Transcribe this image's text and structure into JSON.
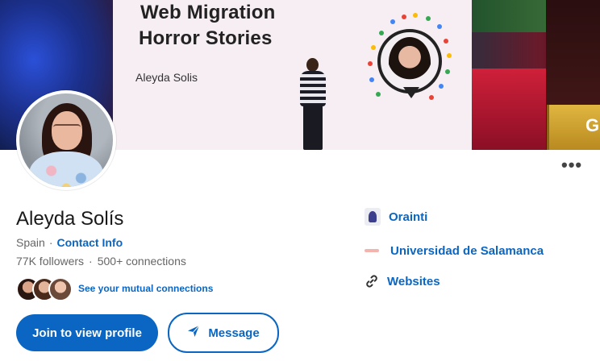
{
  "cover": {
    "talk_title_line1": "Web Migration",
    "talk_title_line2": "Horror Stories",
    "speaker_name": "Aleyda Solis",
    "podium_letter": "G"
  },
  "profile": {
    "name": "Aleyda Solís",
    "location": "Spain",
    "contact_info_label": "Contact Info",
    "followers": "77K followers",
    "connections": "500+ connections",
    "mutual_label": "See your mutual connections"
  },
  "actions": {
    "join_label": "Join to view profile",
    "message_label": "Message",
    "more_label": "•••"
  },
  "sidebar": {
    "company": "Orainti",
    "education": "Universidad de Salamanca",
    "websites": "Websites"
  },
  "icons": {
    "company": "orainti-logo-icon",
    "education": "university-logo-icon",
    "websites": "link-icon",
    "message": "send-icon",
    "more": "more-horizontal-icon"
  },
  "colors": {
    "accent": "#0a66c2",
    "text_primary": "#191919",
    "text_secondary": "#666666"
  }
}
